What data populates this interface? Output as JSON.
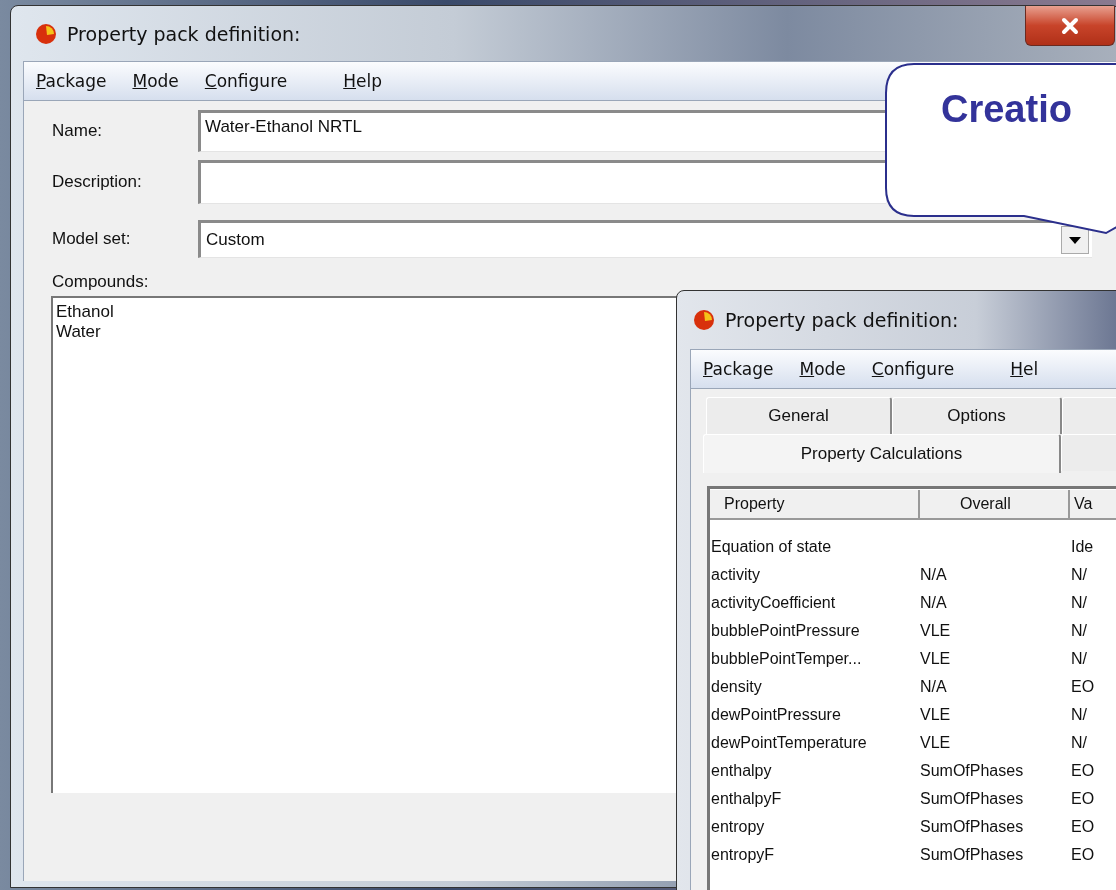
{
  "windows": [
    {
      "title": "Property pack definition:",
      "menu": [
        {
          "key": "P",
          "rest": "ackage"
        },
        {
          "key": "M",
          "rest": "ode"
        },
        {
          "key": "C",
          "rest": "onfigure"
        },
        {
          "key": "H",
          "rest": "elp"
        }
      ],
      "form": {
        "name_label": "Name:",
        "name_value": "Water-Ethanol NRTL",
        "description_label": "Description:",
        "model_set_label": "Model set:",
        "model_set_value": "Custom",
        "compounds_label": "Compounds:",
        "compounds": [
          "Ethanol",
          "Water"
        ]
      }
    },
    {
      "title": "Property pack definition:",
      "menu": [
        {
          "key": "P",
          "rest": "ackage"
        },
        {
          "key": "M",
          "rest": "ode"
        },
        {
          "key": "C",
          "rest": "onfigure"
        },
        {
          "key": "H",
          "rest": "el"
        }
      ],
      "tab_rows": [
        [
          {
            "label": "General",
            "selected": false
          },
          {
            "label": "Options",
            "selected": false
          },
          {
            "selected": false
          }
        ],
        [
          {
            "label": "Property Calculations",
            "selected": true
          },
          {
            "selected": false
          }
        ]
      ],
      "table": {
        "columns": [
          "Property",
          "Overall",
          "Va"
        ],
        "rows": [
          [
            "Equation of state",
            "",
            "Ide"
          ],
          [
            "activity",
            "N/A",
            "N/"
          ],
          [
            "activityCoefficient",
            "N/A",
            "N/"
          ],
          [
            "bubblePointPressure",
            "VLE",
            "N/"
          ],
          [
            "bubblePointTemper...",
            "VLE",
            "N/"
          ],
          [
            "density",
            "N/A",
            "EO"
          ],
          [
            "dewPointPressure",
            "VLE",
            "N/"
          ],
          [
            "dewPointTemperature",
            "VLE",
            "N/"
          ],
          [
            "enthalpy",
            "SumOfPhases",
            "EO"
          ],
          [
            "enthalpyF",
            "SumOfPhases",
            "EO"
          ],
          [
            "entropy",
            "SumOfPhases",
            "EO"
          ],
          [
            "entropyF",
            "SumOfPhases",
            "EO"
          ]
        ]
      }
    }
  ],
  "callout": {
    "text": "Creatio"
  }
}
